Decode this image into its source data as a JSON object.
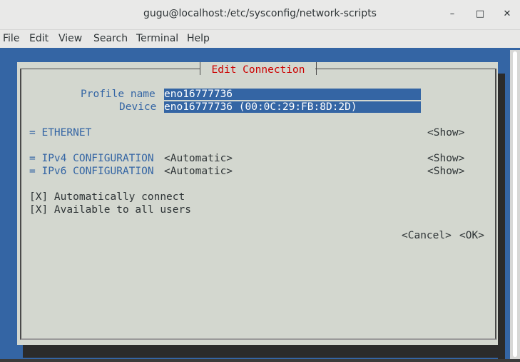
{
  "window": {
    "title": "gugu@localhost:/etc/sysconfig/network-scripts",
    "minimize": "–",
    "maximize": "□",
    "close": "✕"
  },
  "menu": [
    "File",
    "Edit",
    "View",
    "Search",
    "Terminal",
    "Help"
  ],
  "dialog": {
    "title": "Edit Connection",
    "profile_label": "Profile name",
    "profile_value": "eno16777736",
    "device_label": "Device",
    "device_value": "eno16777736 (00:0C:29:FB:8D:2D)",
    "ethernet_label": "= ETHERNET",
    "ethernet_show": "<Show>",
    "ipv4_label": "= IPv4 CONFIGURATION",
    "ipv4_value": "<Automatic>",
    "ipv4_show": "<Show>",
    "ipv6_label": "= IPv6 CONFIGURATION",
    "ipv6_value": "<Automatic>",
    "ipv6_show": "<Show>",
    "auto_connect": "[X] Automatically connect",
    "all_users": "[X] Available to all users",
    "cancel": "<Cancel>",
    "ok": "<OK>"
  },
  "colors": {
    "terminal_bg": "#3465a4",
    "dialog_bg": "#d3d7cf",
    "title_red": "#cc0000",
    "field_bg": "#3465a4"
  }
}
